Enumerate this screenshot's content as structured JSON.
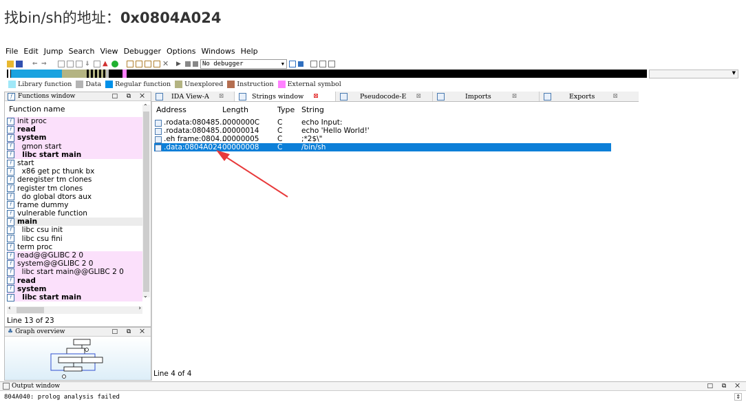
{
  "headline": {
    "prefix": "找bin/sh的地址：",
    "address": "0x0804A024"
  },
  "menu": [
    "File",
    "Edit",
    "Jump",
    "Search",
    "View",
    "Debugger",
    "Options",
    "Windows",
    "Help"
  ],
  "toolbar": {
    "debugger_select": "No debugger"
  },
  "legend": [
    {
      "label": "Library function",
      "color": "#a0e8f8"
    },
    {
      "label": "Data",
      "color": "#b4b4b4"
    },
    {
      "label": "Regular function",
      "color": "#0090e8"
    },
    {
      "label": "Unexplored",
      "color": "#b4b482"
    },
    {
      "label": "Instruction",
      "color": "#b46e50"
    },
    {
      "label": "External symbol",
      "color": "#ff80ff"
    }
  ],
  "functions_window": {
    "title": "Functions window",
    "column": "Function name",
    "rows": [
      {
        "name": "init proc",
        "style": "pink"
      },
      {
        "name": "read",
        "style": "pink-bold"
      },
      {
        "name": "system",
        "style": "pink-bold"
      },
      {
        "name": "  gmon start",
        "style": "pink"
      },
      {
        "name": "  libc start main",
        "style": "pink-bold"
      },
      {
        "name": "start",
        "style": "plain"
      },
      {
        "name": "  x86 get pc thunk bx",
        "style": "plain"
      },
      {
        "name": "deregister tm clones",
        "style": "plain"
      },
      {
        "name": "register tm clones",
        "style": "plain"
      },
      {
        "name": "  do global dtors aux",
        "style": "plain"
      },
      {
        "name": "frame dummy",
        "style": "plain"
      },
      {
        "name": "vulnerable function",
        "style": "plain"
      },
      {
        "name": "main",
        "style": "grey-bold"
      },
      {
        "name": "  libc csu init",
        "style": "plain"
      },
      {
        "name": "  libc csu fini",
        "style": "plain"
      },
      {
        "name": "term proc",
        "style": "plain"
      },
      {
        "name": "read@@GLIBC 2 0",
        "style": "pink"
      },
      {
        "name": "system@@GLIBC 2 0",
        "style": "pink"
      },
      {
        "name": "  libc start main@@GLIBC 2 0",
        "style": "pink"
      },
      {
        "name": "read",
        "style": "pink-bold"
      },
      {
        "name": "system",
        "style": "pink-bold"
      },
      {
        "name": "  libc start main",
        "style": "pink-bold"
      }
    ],
    "status": "Line 13 of 23"
  },
  "graph_overview": {
    "title": "Graph overview"
  },
  "tabs": [
    {
      "label": "IDA View-A",
      "active": false
    },
    {
      "label": "Strings window",
      "active": true
    },
    {
      "label": "Pseudocode-E",
      "active": false
    },
    {
      "label": "Imports",
      "active": false
    },
    {
      "label": "Exports",
      "active": false
    }
  ],
  "strings_window": {
    "columns": {
      "address": "Address",
      "length": "Length",
      "type": "Type",
      "string": "String"
    },
    "rows": [
      {
        "address": ".rodata:080485...",
        "length": "0000000C",
        "type": "C",
        "string": "echo Input:",
        "selected": false
      },
      {
        "address": ".rodata:080485...",
        "length": "00000014",
        "type": "C",
        "string": "echo 'Hello World!'",
        "selected": false
      },
      {
        "address": ".eh frame:0804...",
        "length": "00000005",
        "type": "C",
        "string": ";*2$\\\"",
        "selected": false
      },
      {
        "address": ".data:0804A024",
        "length": "00000008",
        "type": "C",
        "string": "/bin/sh",
        "selected": true
      }
    ],
    "status": "Line 4 of 4"
  },
  "output_window": {
    "title": "Output window",
    "text": "804A040: prolog analysis failed"
  },
  "colors": {
    "selection": "#0c7fd8",
    "arrow": "#e8393a",
    "pink_row": "#fbe0fb"
  }
}
